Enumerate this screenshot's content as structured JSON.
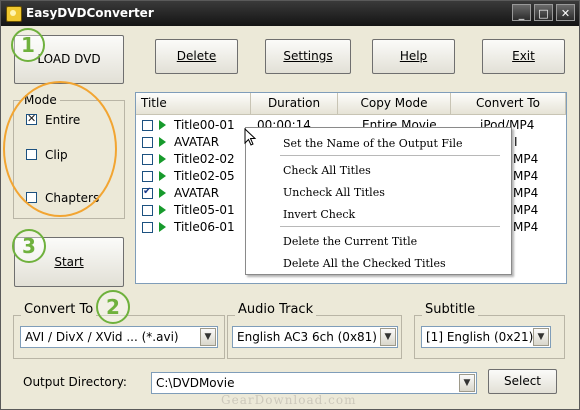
{
  "window": {
    "title": "EasyDVDConverter"
  },
  "window_controls": {
    "minimize": "_",
    "maximize": "□",
    "close": "✕"
  },
  "toolbar": {
    "load_dvd": "LOAD DVD",
    "delete": "Delete",
    "settings": "Settings",
    "help": "Help",
    "exit": "Exit"
  },
  "steps": {
    "one": "1",
    "two": "2",
    "three": "3"
  },
  "mode": {
    "label": "Mode",
    "options": [
      {
        "label": "Entire",
        "checked": true
      },
      {
        "label": "Clip",
        "checked": false
      },
      {
        "label": "Chapters",
        "checked": false
      }
    ]
  },
  "start_button": "Start",
  "titles_table": {
    "columns": [
      "Title",
      "Duration",
      "Copy Mode",
      "Convert To"
    ],
    "rows": [
      {
        "title": "Title00-01",
        "duration": "00:00:14",
        "copy_mode": "Entire Movie",
        "convert_to": "iPod/MP4",
        "checked": false
      },
      {
        "title": "AVATAR",
        "duration": "",
        "copy_mode": "",
        "convert_to": "I",
        "checked": false
      },
      {
        "title": "Title02-02",
        "duration": "",
        "copy_mode": "",
        "convert_to": "MP4",
        "checked": false
      },
      {
        "title": "Title02-05",
        "duration": "",
        "copy_mode": "",
        "convert_to": "MP4",
        "checked": false
      },
      {
        "title": "AVATAR",
        "duration": "",
        "copy_mode": "",
        "convert_to": "MP4",
        "checked": true
      },
      {
        "title": "Title05-01",
        "duration": "",
        "copy_mode": "",
        "convert_to": "MP4",
        "checked": false
      },
      {
        "title": "Title06-01",
        "duration": "",
        "copy_mode": "",
        "convert_to": "MP4",
        "checked": false
      }
    ]
  },
  "context_menu": {
    "items": [
      "Set the Name of the Output File",
      "Check All Titles",
      "Uncheck All Titles",
      "Invert Check",
      "Delete the Current Title",
      "Delete All the Checked Titles"
    ]
  },
  "convert_to": {
    "label": "Convert To",
    "value": "AVI / DivX / XVid ... (*.avi)"
  },
  "audio_track": {
    "label": "Audio Track",
    "value": "English AC3 6ch (0x81)"
  },
  "subtitle": {
    "label": "Subtitle",
    "value": "[1] English (0x21)"
  },
  "output": {
    "label": "Output Directory:",
    "value": "C:\\DVDMovie",
    "select_button": "Select"
  },
  "watermark": "GearDownload.com",
  "colors": {
    "accent_green": "#6fb13d",
    "highlight_orange": "#f2a532",
    "play_green": "#179a2c"
  }
}
